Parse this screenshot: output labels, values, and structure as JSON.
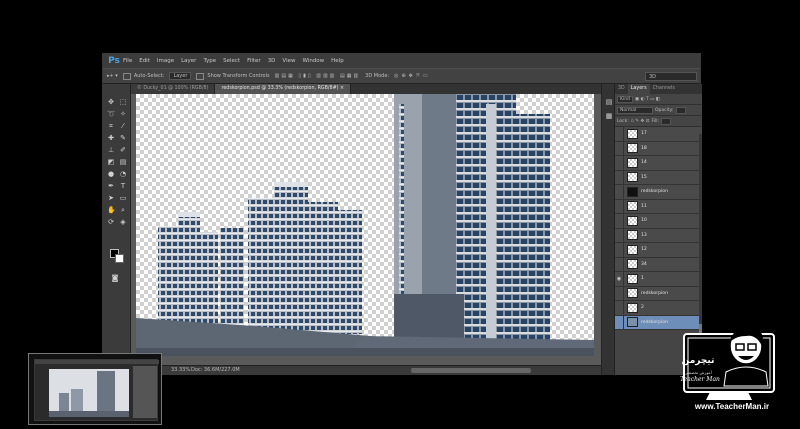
{
  "app": {
    "logo": "Ps",
    "menu": [
      "File",
      "Edit",
      "Image",
      "Layer",
      "Type",
      "Select",
      "Filter",
      "3D",
      "View",
      "Window",
      "Help"
    ]
  },
  "options": {
    "auto_select_label": "Auto-Select:",
    "auto_select_value": "Layer",
    "transform_label": "Show Transform Controls",
    "mode_3d_label": "3D Mode:",
    "workspace": "3D"
  },
  "tabs": [
    {
      "label": "© Ducky_01 @ 100% (RGB/8)",
      "active": false
    },
    {
      "label": "redskorpion.psd @ 33.3% (redskorpion, RGB/8#) ×",
      "active": true
    }
  ],
  "status": {
    "zoom": "33.33%",
    "doc": "Doc: 36.6M/227.0M"
  },
  "layers_panel": {
    "tabs": [
      {
        "label": "3D",
        "active": false
      },
      {
        "label": "Layers",
        "active": true
      },
      {
        "label": "Channels",
        "active": false
      }
    ],
    "kind_label": "Kind",
    "blend_mode": "Normal",
    "opacity_label": "Opacity:",
    "lock_label": "Lock:",
    "fill_label": "Fill:",
    "layers": [
      {
        "name": "17",
        "thumb": "check",
        "visible": false,
        "selected": false
      },
      {
        "name": "18",
        "thumb": "check",
        "visible": false,
        "selected": false
      },
      {
        "name": "14",
        "thumb": "check",
        "visible": false,
        "selected": false
      },
      {
        "name": "15",
        "thumb": "check",
        "visible": false,
        "selected": false
      },
      {
        "name": "redskorpion",
        "thumb": "dark",
        "visible": false,
        "selected": false
      },
      {
        "name": "11",
        "thumb": "check",
        "visible": false,
        "selected": false
      },
      {
        "name": "10",
        "thumb": "check",
        "visible": false,
        "selected": false
      },
      {
        "name": "13",
        "thumb": "check",
        "visible": false,
        "selected": false
      },
      {
        "name": "12",
        "thumb": "check",
        "visible": false,
        "selected": false
      },
      {
        "name": "34",
        "thumb": "check",
        "visible": false,
        "selected": false
      },
      {
        "name": "1",
        "thumb": "check",
        "visible": true,
        "selected": false
      },
      {
        "name": "redskorpion",
        "thumb": "check",
        "visible": false,
        "selected": false
      },
      {
        "name": "2",
        "thumb": "check",
        "visible": false,
        "selected": false
      },
      {
        "name": "redskorpion",
        "thumb": "img",
        "visible": false,
        "selected": true
      }
    ]
  },
  "logo": {
    "fa": "تیچرمن",
    "sub": "آموزش تخصصی",
    "en": "Teacher Man",
    "site": "www.TeacherMan.ir"
  }
}
